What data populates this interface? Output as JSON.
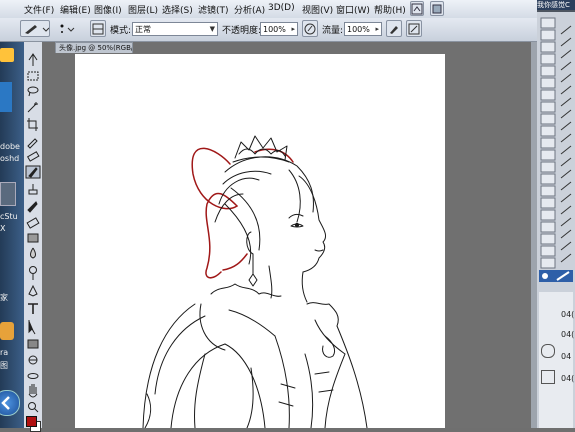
{
  "menu": [
    "文件(F)",
    "编辑(E)",
    "图像(I)",
    "图层(L)",
    "选择(S)",
    "滤镜(T)",
    "分析(A)",
    "3D(D)",
    "视图(V)",
    "窗口(W)",
    "帮助(H)"
  ],
  "options": {
    "mode_label": "模式:",
    "mode_value": "正常",
    "opacity_label": "不透明度:",
    "opacity_value": "100%",
    "flow_label": "流量:",
    "flow_value": "100%"
  },
  "doc_tab": "头像.jpg @ 50%(RGB/8)",
  "right_title": "我你感觉C",
  "right_rows": [
    "04(",
    "04(",
    "04",
    "04("
  ],
  "desktop": [
    "dobe",
    "oshd",
    "cStu",
    "X",
    "家",
    "ra",
    "图"
  ],
  "colors": {
    "foreground": "#b01010",
    "background": "#ffffff",
    "line_red": "#a01818",
    "line_black": "#1a1a1a"
  },
  "icons": [
    "brush-icon",
    "move-icon",
    "marquee-icon",
    "lasso-icon",
    "magic-wand-icon",
    "crop-icon",
    "eyedropper-icon",
    "heal-icon",
    "brush-tool-icon",
    "stamp-icon",
    "history-brush-icon",
    "eraser-icon",
    "gradient-icon",
    "blur-icon",
    "dodge-icon",
    "pen-icon",
    "text-icon",
    "path-select-icon",
    "shape-icon",
    "3d-rotate-icon",
    "3d-orbit-icon",
    "hand-icon",
    "zoom-icon"
  ]
}
